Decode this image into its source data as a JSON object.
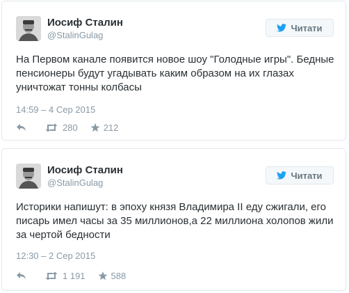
{
  "colors": {
    "accent": "#1da1f2",
    "text": "#292f33",
    "muted": "#8899a6",
    "border": "#e1e8ed"
  },
  "tweets": [
    {
      "name": "Иосиф Сталин",
      "handle": "@StalinGulag",
      "follow_label": "Читати",
      "text": "На Первом канале появится новое шоу \"Голодные игры\". Бедные пенсионеры будут угадывать каким образом на их глазах уничтожат тонны колбасы",
      "timestamp": "14:59 – 4 Сер 2015",
      "retweets": "280",
      "likes": "212"
    },
    {
      "name": "Иосиф Сталин",
      "handle": "@StalinGulag",
      "follow_label": "Читати",
      "text": "Историки напишут: в эпоху князя Владимира II еду сжигали, его писарь имел часы за 35 миллионов,а 22 миллиона холопов жили за чертой бедности",
      "timestamp": "12:30 – 2 Сер 2015",
      "retweets": "1 191",
      "likes": "588"
    }
  ],
  "icons": {
    "follow": "twitter-bird-icon",
    "reply": "reply-icon",
    "retweet": "retweet-icon",
    "like": "star-icon",
    "avatar": "stalin-portrait"
  }
}
